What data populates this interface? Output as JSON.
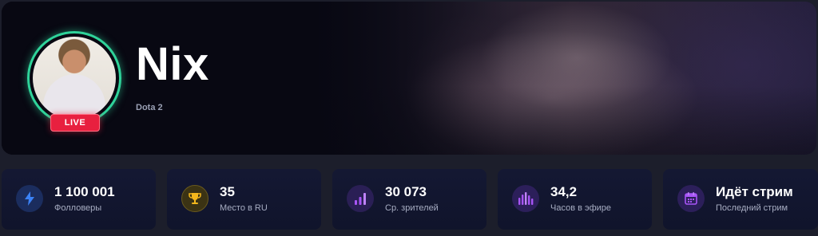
{
  "streamer": {
    "name": "Nix",
    "game": "Dota 2",
    "live_badge": "LIVE"
  },
  "stats": [
    {
      "value": "1 100 001",
      "label": "Фолловеры",
      "icon": "lightning-icon",
      "color": "#3b82f6"
    },
    {
      "value": "35",
      "label": "Место в RU",
      "icon": "trophy-icon",
      "color": "#f5b81c"
    },
    {
      "value": "30 073",
      "label": "Ср. зрителей",
      "icon": "bar-chart-icon",
      "color": "#a855f7"
    },
    {
      "value": "34,2",
      "label": "Часов в эфире",
      "icon": "bars-icon",
      "color": "#a855f7"
    },
    {
      "value": "Идёт стрим",
      "label": "Последний стрим",
      "icon": "calendar-icon",
      "color": "#a855f7"
    }
  ],
  "colors": {
    "live": "#e8203f",
    "avatar_ring": "#2fd39a",
    "card_bg": "#141833",
    "page_bg": "#1c1e2b"
  }
}
